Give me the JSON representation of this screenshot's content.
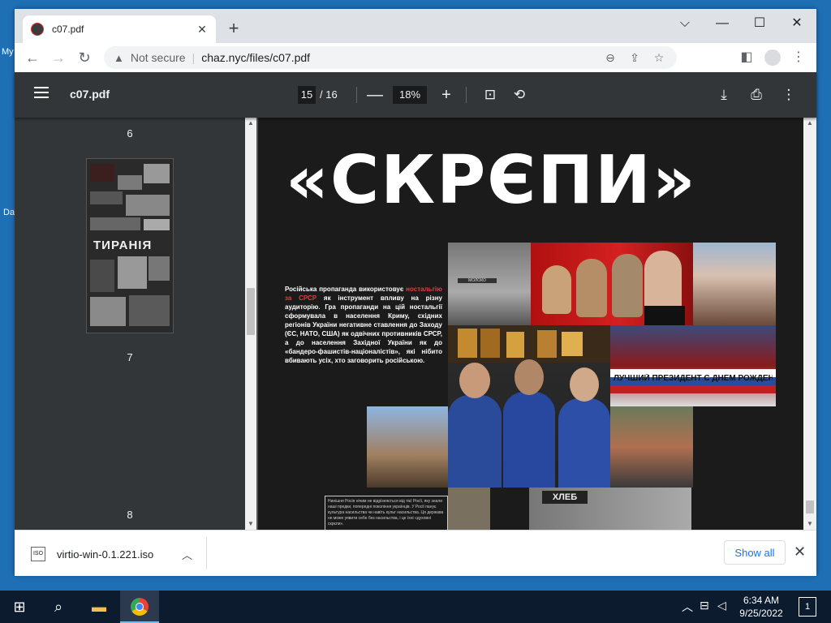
{
  "desktop": {
    "icon_label_1": "My",
    "icon_label_2": "Da"
  },
  "window": {
    "tab_title": "c07.pdf",
    "tab_close": "✕",
    "new_tab": "+",
    "minimize": "⌵",
    "restore": "—",
    "maximize": "☐",
    "close": "✕"
  },
  "toolbar": {
    "back": "←",
    "forward": "→",
    "reload": "↻",
    "security_text": "Not secure",
    "url": "chaz.nyc/files/c07.pdf"
  },
  "pdf": {
    "file_title": "c07.pdf",
    "current_page": "15",
    "total_pages": "/ 16",
    "zoom_out": "—",
    "zoom": "18%",
    "zoom_in": "+",
    "thumb_pages": [
      "6",
      "7",
      "8"
    ],
    "thumb_heading": "ТИРАНІЯ",
    "page_title": "«СКРЄПИ»",
    "body_text_a": "Російська пропаганда використовує ",
    "body_text_highlight": "ностальгію за СРСР",
    "body_text_b": " як інструмент впливу на різну аудиторію. Гра пропаганди на цій ностальгії сформувала в населення Криму, східних регіонів України негативне ставлення до Заходу (ЄС, НАТО, США) як одвічних противників СРСР, а до населення Західної України як до «бандеро-фашистів-націоналістів», які нібито вбивають усіх, хто заговорить російською.",
    "caption_text": "Нинішня Росія нічим не відрізняється від тієї Росії, яку знали наші предки, попередні покоління українців. У Росії панує культура насильства чи навіть культ насильства. Ця держава не може уявити себе без насильства, і це їхні «духовні скрєпи».",
    "banner_text": "ЛУЧШИЙ ПРЕЗИДЕНТ С ДНЕМ РОЖДЕНИЯ",
    "bread_sign": "ХЛЕБ",
    "shop_sign": "МОЛОКО"
  },
  "download": {
    "file_name": "virtio-win-0.1.221.iso",
    "file_icon_text": "ISO",
    "show_all": "Show all",
    "close": "✕"
  },
  "taskbar": {
    "time": "6:34 AM",
    "date": "9/25/2022",
    "notification_count": "1"
  },
  "colors": {
    "accent_link": "#1a73e8",
    "pdf_toolbar": "#323639",
    "highlight_red": "#e63b3b"
  }
}
